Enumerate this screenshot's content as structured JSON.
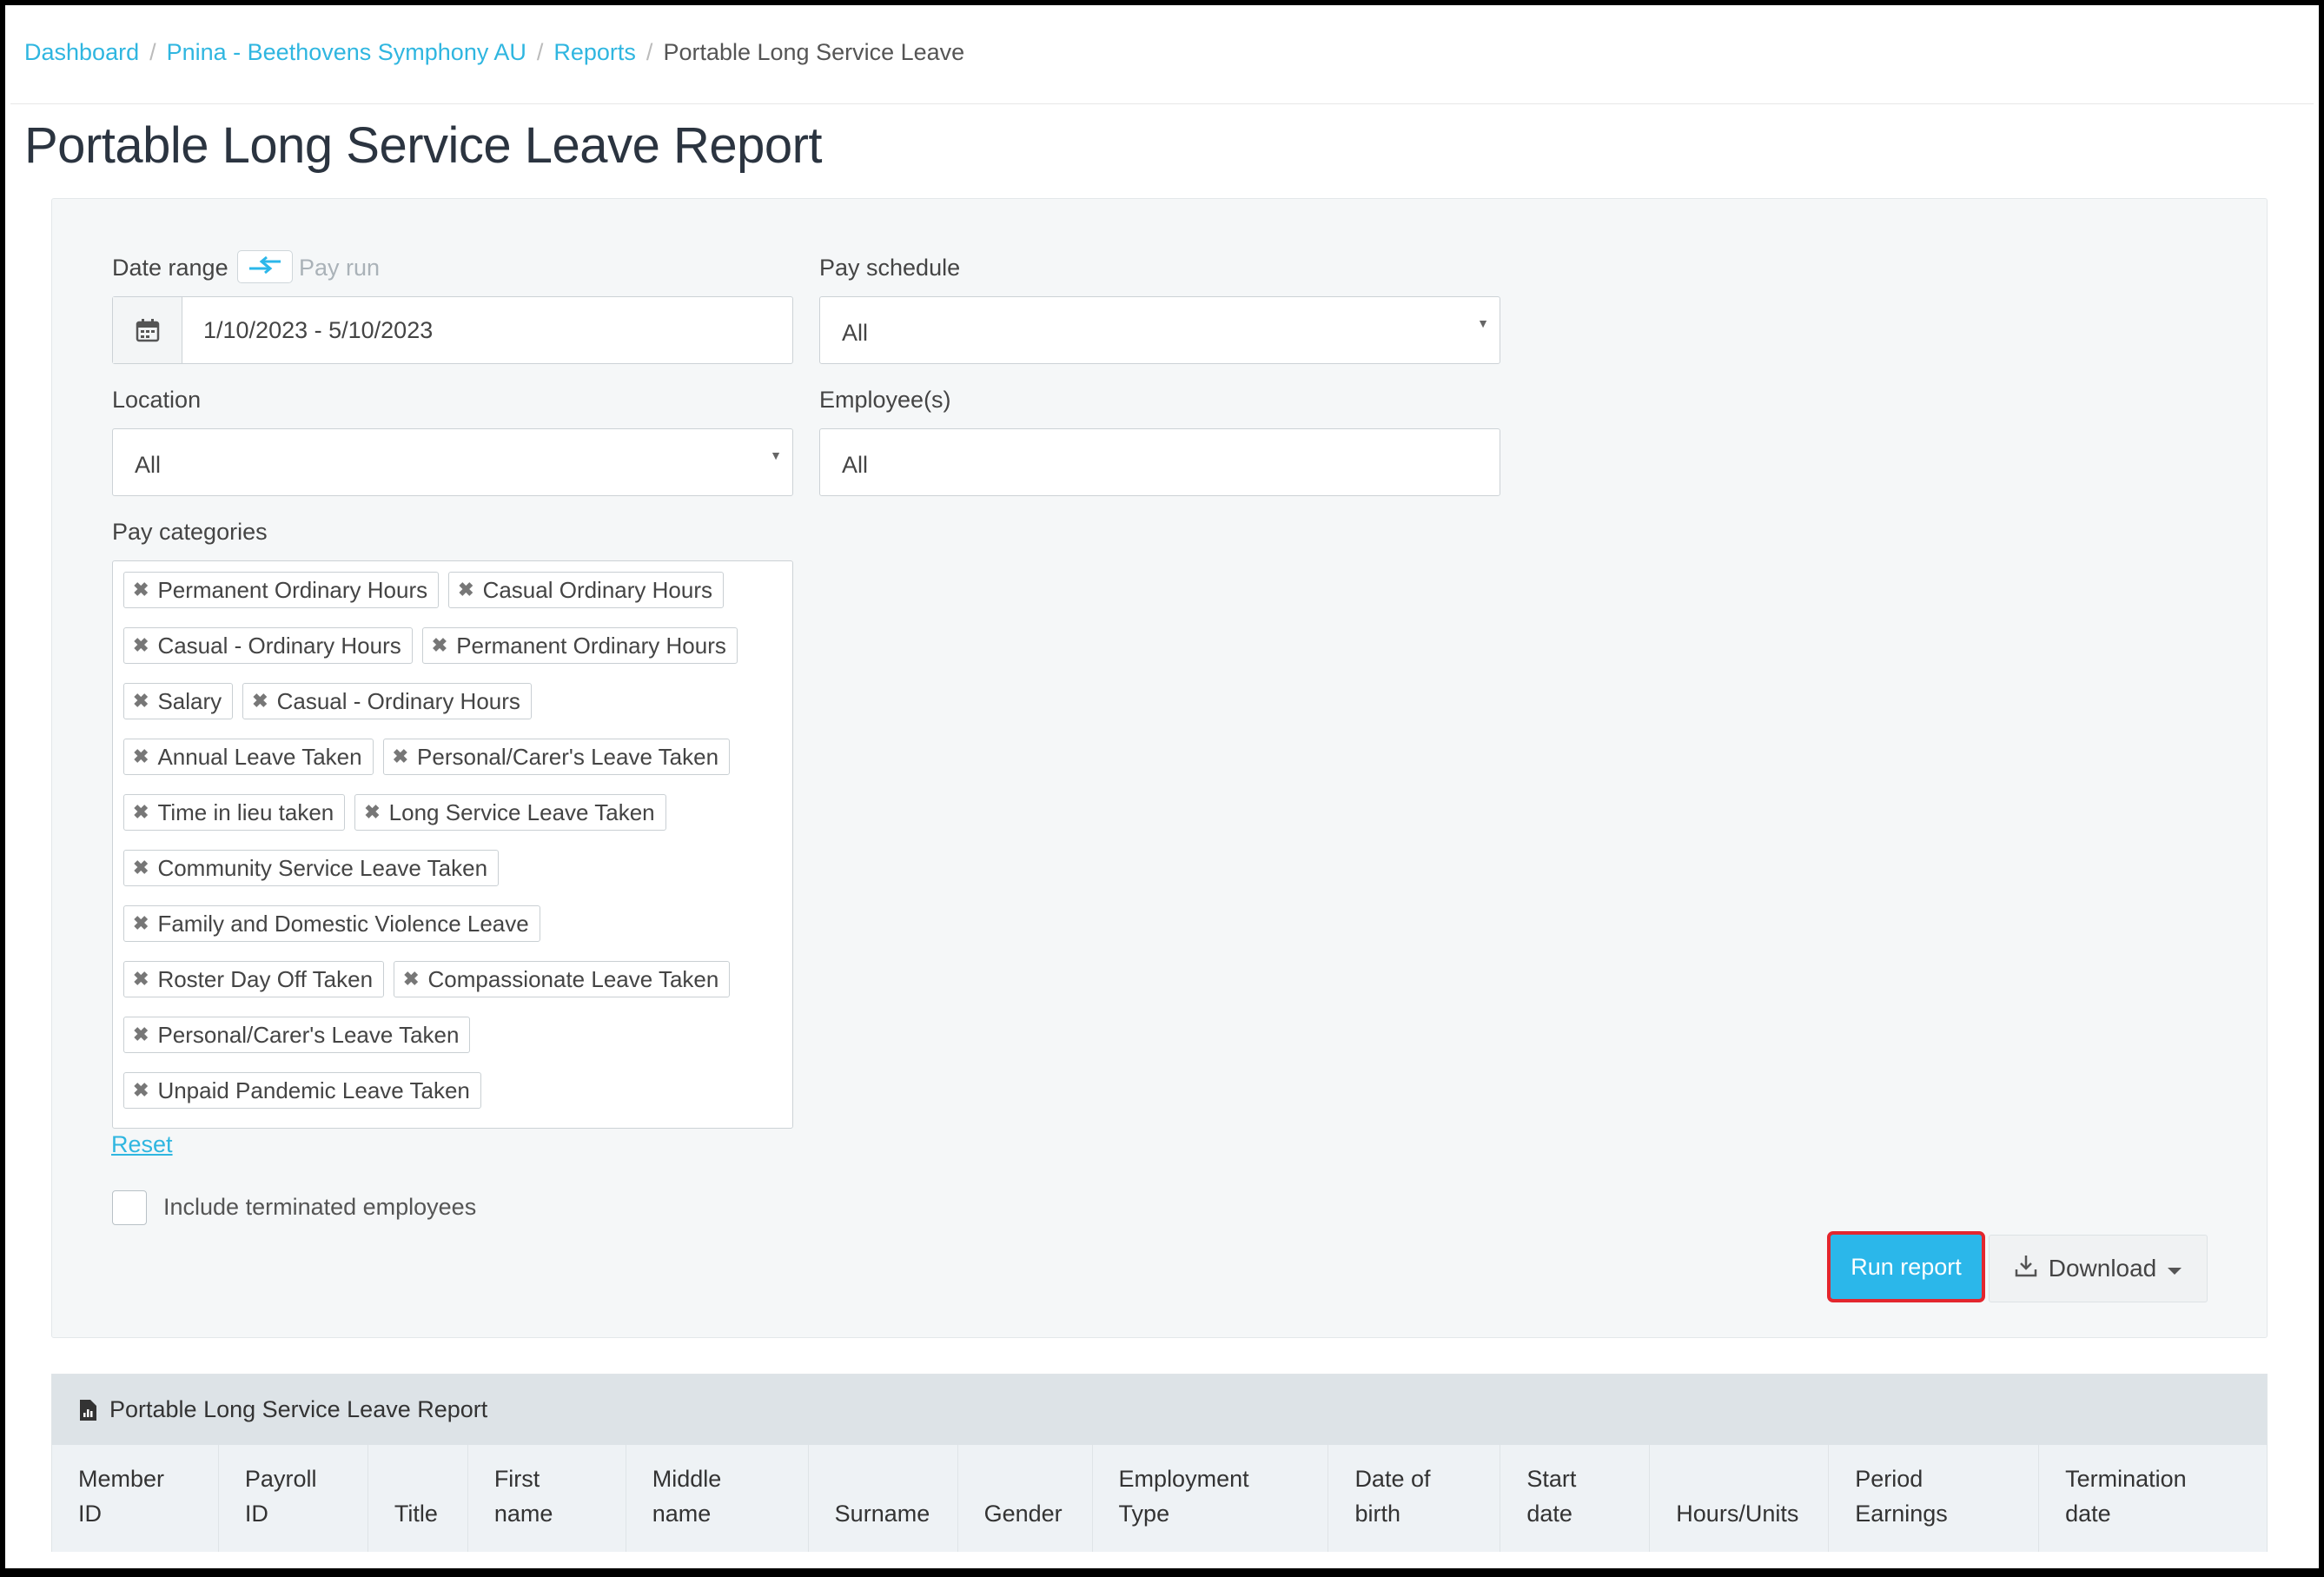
{
  "breadcrumb": {
    "items": [
      "Dashboard",
      "Pnina - Beethovens Symphony AU",
      "Reports"
    ],
    "separator": "/",
    "current": "Portable Long Service Leave"
  },
  "page_title": "Portable Long Service Leave Report",
  "filters": {
    "date_range": {
      "label": "Date range",
      "toggle_icon": "swap-arrows-icon",
      "alt_mode_label": "Pay run",
      "value": "1/10/2023 - 5/10/2023"
    },
    "pay_schedule": {
      "label": "Pay schedule",
      "value": "All"
    },
    "location": {
      "label": "Location",
      "value": "All"
    },
    "employees": {
      "label": "Employee(s)",
      "value": "All"
    },
    "pay_categories": {
      "label": "Pay categories",
      "rows": [
        [
          "Permanent Ordinary Hours",
          "Casual Ordinary Hours"
        ],
        [
          "Casual - Ordinary Hours",
          "Permanent Ordinary Hours"
        ],
        [
          "Salary",
          "Casual - Ordinary Hours"
        ],
        [
          "Annual Leave Taken",
          "Personal/Carer's Leave Taken"
        ],
        [
          "Time in lieu taken",
          "Long Service Leave Taken"
        ],
        [
          "Community Service Leave Taken"
        ],
        [
          "Family and Domestic Violence Leave"
        ],
        [
          "Roster Day Off Taken",
          "Compassionate Leave Taken"
        ],
        [
          "Personal/Carer's Leave Taken"
        ],
        [
          "Unpaid Pandemic Leave Taken"
        ]
      ]
    },
    "reset_label": "Reset",
    "include_terminated": {
      "label": "Include terminated employees",
      "checked": false
    }
  },
  "actions": {
    "run_label": "Run report",
    "download_label": "Download"
  },
  "report": {
    "title": "Portable Long Service Leave Report",
    "columns": [
      [
        "Member",
        "ID"
      ],
      [
        "Payroll",
        "ID"
      ],
      [
        "",
        "Title"
      ],
      [
        "First",
        "name"
      ],
      [
        "Middle",
        "name"
      ],
      [
        "",
        "Surname"
      ],
      [
        "",
        "Gender"
      ],
      [
        "Employment",
        "Type"
      ],
      [
        "Date of",
        "birth"
      ],
      [
        "Start",
        "date"
      ],
      [
        "",
        "Hours/Units"
      ],
      [
        "Period",
        "Earnings"
      ],
      [
        "Termination",
        "date"
      ]
    ]
  },
  "colors": {
    "accent": "#2bb7ea",
    "link": "#2fb6e0",
    "highlight": "#e3262e"
  }
}
